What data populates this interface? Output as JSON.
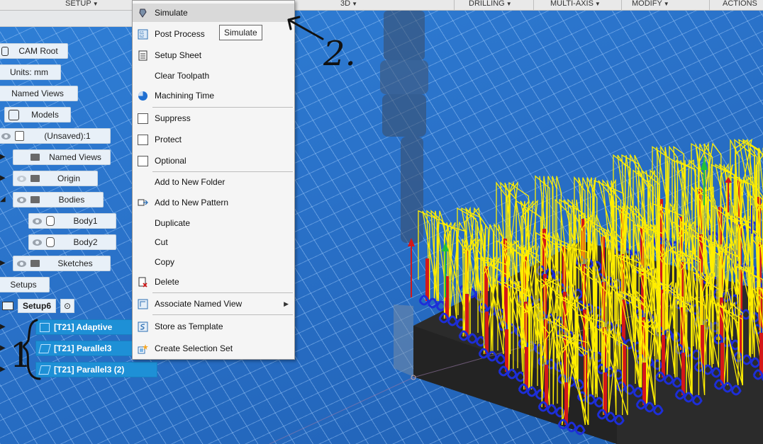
{
  "toolbar": {
    "items": [
      "SETUP",
      "3D",
      "DRILLING",
      "MULTI-AXIS",
      "MODIFY",
      "ACTIONS"
    ]
  },
  "browser": {
    "root": "CAM Root",
    "units": "Units: mm",
    "named_views": "Named Views",
    "models": "Models",
    "unsaved": "(Unsaved):1",
    "named_views_2": "Named Views",
    "origin": "Origin",
    "bodies": "Bodies",
    "body1": "Body1",
    "body2": "Body2",
    "sketches": "Sketches",
    "setups": "Setups",
    "setup6": "Setup6",
    "ops": [
      "[T21] Adaptive",
      "[T21] Parallel3",
      "[T21] Parallel3 (2)"
    ]
  },
  "context_menu": {
    "items": [
      {
        "label": "Simulate",
        "icon": "simulate-icon"
      },
      {
        "label": "Post Process",
        "icon": "post-process-icon"
      },
      {
        "label": "Setup Sheet",
        "icon": "setup-sheet-icon"
      },
      {
        "label": "Clear Toolpath",
        "icon": ""
      },
      {
        "label": "Machining Time",
        "icon": "machining-time-icon"
      },
      {
        "label": "Suppress",
        "icon": "checkbox"
      },
      {
        "label": "Protect",
        "icon": "checkbox"
      },
      {
        "label": "Optional",
        "icon": "checkbox"
      },
      {
        "label": "Add to New Folder",
        "icon": ""
      },
      {
        "label": "Add to New Pattern",
        "icon": "pattern-icon"
      },
      {
        "label": "Duplicate",
        "icon": ""
      },
      {
        "label": "Cut",
        "icon": ""
      },
      {
        "label": "Copy",
        "icon": ""
      },
      {
        "label": "Delete",
        "icon": "delete-icon"
      },
      {
        "label": "Associate Named View",
        "icon": "named-view-icon"
      },
      {
        "label": "Store as Template",
        "icon": "template-icon"
      },
      {
        "label": "Create Selection Set",
        "icon": "selection-set-icon"
      }
    ],
    "tooltip": "Simulate"
  },
  "annotations": {
    "step_2": "2.",
    "step_1": "1"
  },
  "colors": {
    "viewport": "#2a72c9",
    "selection": "#1e90d6",
    "toolpath_yellow": "#ffee00",
    "toolpath_red": "#d41818",
    "toolpath_blue": "#1d2ed8",
    "stock": "#2b2b2b"
  }
}
